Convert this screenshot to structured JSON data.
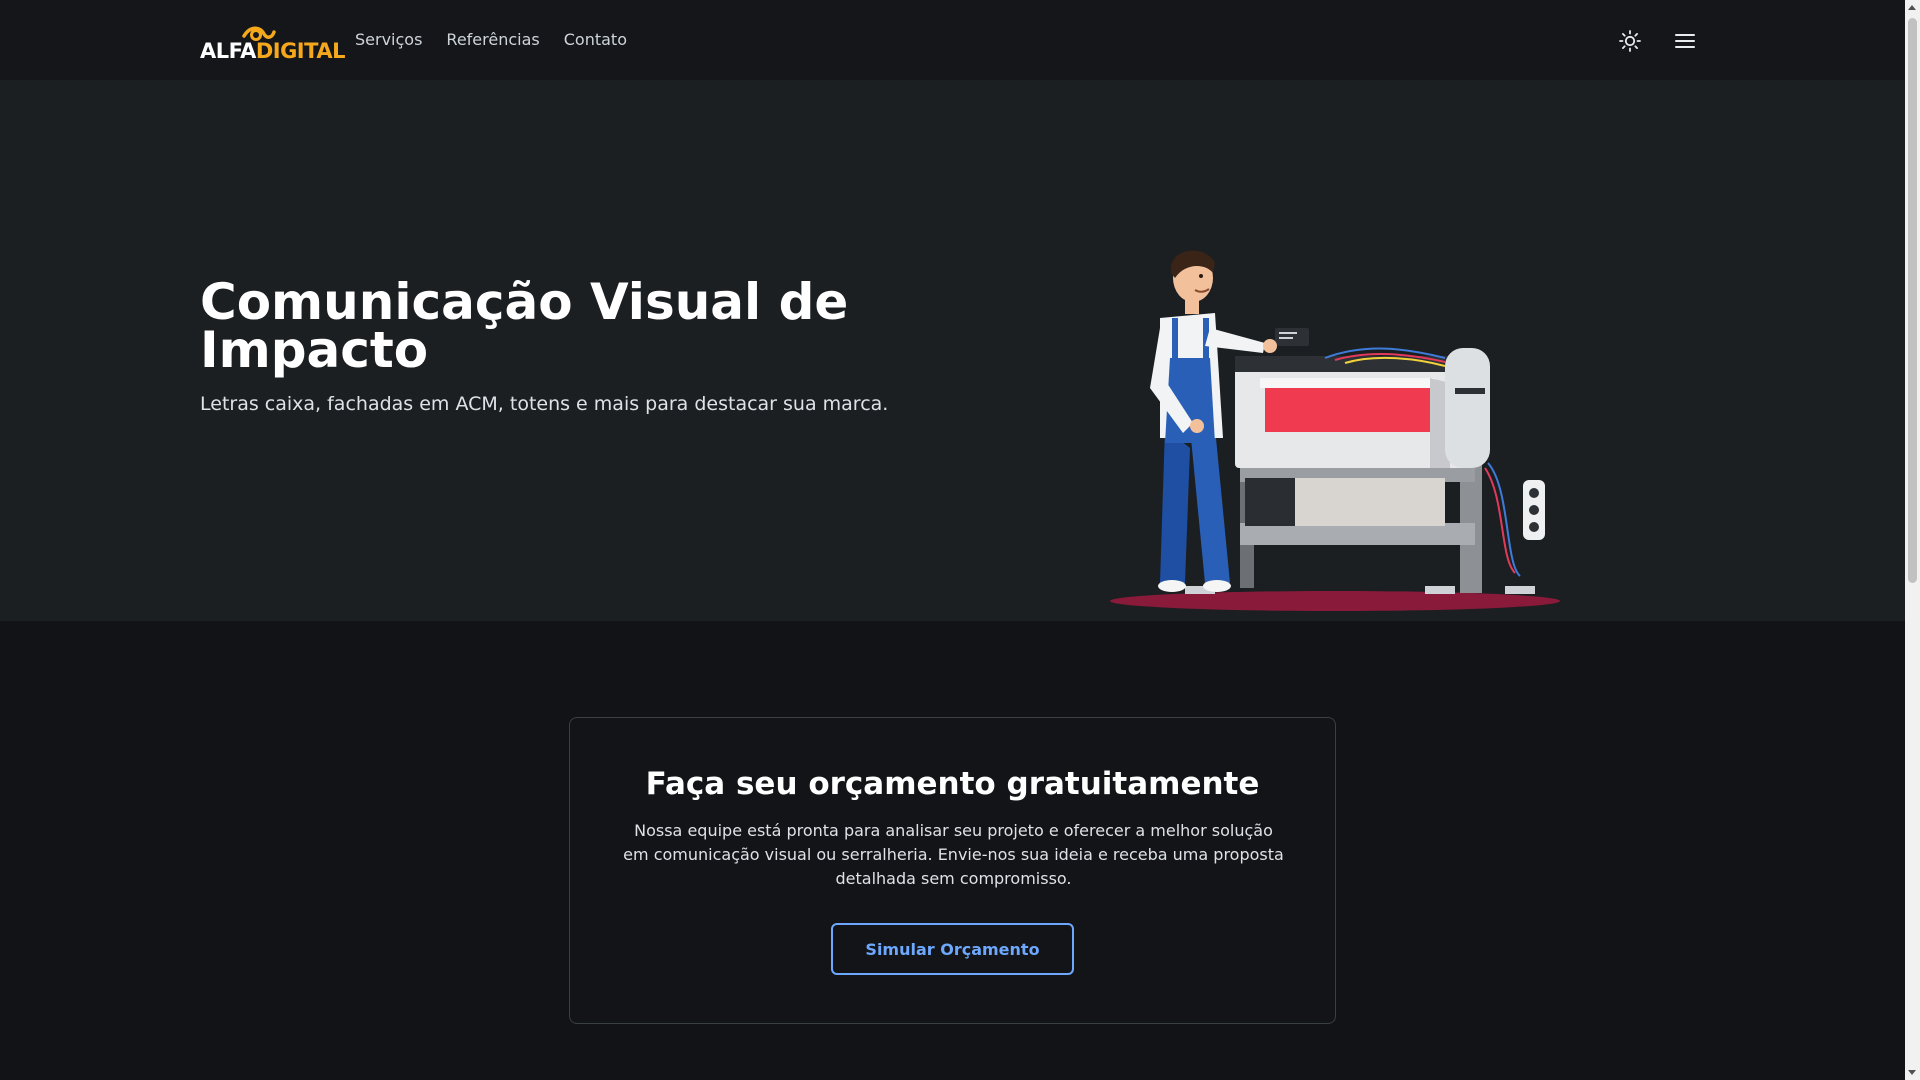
{
  "navbar": {
    "logo_alfa": "ALFA",
    "logo_digital": "DIGITAL",
    "links": [
      "Serviços",
      "Referências",
      "Contato"
    ]
  },
  "hero": {
    "title": "Comunicação Visual de Impacto",
    "subtitle": "Letras caixa, fachadas em ACM, totens e mais para destacar sua marca."
  },
  "cta": {
    "title": "Faça seu orçamento gratuitamente",
    "text": "Nossa equipe está pronta para analisar seu projeto e oferecer a melhor solução em comunicação visual ou serralheria. Envie-nos sua ideia e receba uma proposta detalhada sem compromisso.",
    "button_label": "Simular Orçamento"
  },
  "icons": {
    "theme_toggle": "sun-icon",
    "menu": "hamburger-menu-icon",
    "illustration": "printer-technician-illustration"
  },
  "colors": {
    "nav_bg": "#14161a",
    "hero_bg": "#1b1f22",
    "page_bg": "#111316",
    "logo_accent": "#f5a81c",
    "button_accent": "#6ea8fe"
  }
}
